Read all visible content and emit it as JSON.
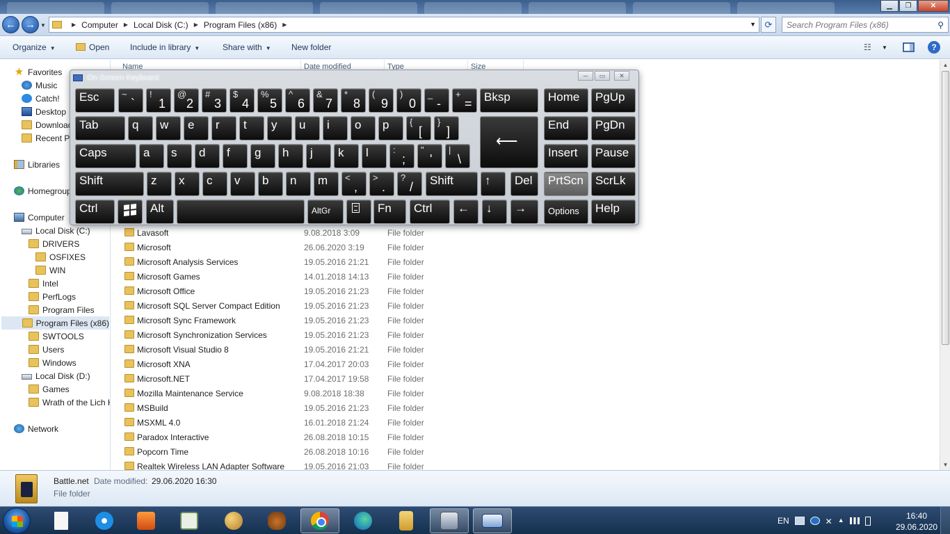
{
  "address_bar": {
    "crumbs": [
      "Computer",
      "Local Disk (C:)",
      "Program Files (x86)"
    ],
    "search_placeholder": "Search Program Files (x86)"
  },
  "toolbar": {
    "organize": "Organize",
    "open": "Open",
    "include": "Include in library",
    "share": "Share with",
    "new_folder": "New folder"
  },
  "nav": {
    "favorites": "Favorites",
    "music": "Music",
    "catch": "Catch!",
    "desktop": "Desktop",
    "downloads": "Download",
    "recent": "Recent Pl",
    "libraries": "Libraries",
    "homegroup": "Homegroup",
    "computer": "Computer",
    "local_c": "Local Disk (C:)",
    "drivers": "DRIVERS",
    "osfixes": "OSFIXES",
    "win": "WIN",
    "intel": "Intel",
    "perflogs": "PerfLogs",
    "program_files": "Program Files",
    "program_files_x86": "Program Files (x86)",
    "swtools": "SWTOOLS",
    "users": "Users",
    "windows": "Windows",
    "local_d": "Local Disk (D:)",
    "games": "Games",
    "wrath": "Wrath of the Lich Ki",
    "network": "Network"
  },
  "columns": {
    "name": "Name",
    "date": "Date modified",
    "type": "Type",
    "size": "Size"
  },
  "files": [
    {
      "name": "Lavasoft",
      "date": "9.08.2018 3:09",
      "type": "File folder"
    },
    {
      "name": "Microsoft",
      "date": "26.06.2020 3:19",
      "type": "File folder"
    },
    {
      "name": "Microsoft Analysis Services",
      "date": "19.05.2016 21:21",
      "type": "File folder"
    },
    {
      "name": "Microsoft Games",
      "date": "14.01.2018 14:13",
      "type": "File folder"
    },
    {
      "name": "Microsoft Office",
      "date": "19.05.2016 21:23",
      "type": "File folder"
    },
    {
      "name": "Microsoft SQL Server Compact Edition",
      "date": "19.05.2016 21:23",
      "type": "File folder"
    },
    {
      "name": "Microsoft Sync Framework",
      "date": "19.05.2016 21:23",
      "type": "File folder"
    },
    {
      "name": "Microsoft Synchronization Services",
      "date": "19.05.2016 21:23",
      "type": "File folder"
    },
    {
      "name": "Microsoft Visual Studio 8",
      "date": "19.05.2016 21:21",
      "type": "File folder"
    },
    {
      "name": "Microsoft XNA",
      "date": "17.04.2017 20:03",
      "type": "File folder"
    },
    {
      "name": "Microsoft.NET",
      "date": "17.04.2017 19:58",
      "type": "File folder"
    },
    {
      "name": "Mozilla Maintenance Service",
      "date": "9.08.2018 18:38",
      "type": "File folder"
    },
    {
      "name": "MSBuild",
      "date": "19.05.2016 21:23",
      "type": "File folder"
    },
    {
      "name": "MSXML 4.0",
      "date": "16.01.2018 21:24",
      "type": "File folder"
    },
    {
      "name": "Paradox Interactive",
      "date": "26.08.2018 10:15",
      "type": "File folder"
    },
    {
      "name": "Popcorn Time",
      "date": "26.08.2018 10:16",
      "type": "File folder"
    },
    {
      "name": "Realtek Wireless LAN Adapter Software",
      "date": "19.05.2016 21:03",
      "type": "File folder"
    }
  ],
  "details": {
    "name": "Battle.net",
    "date_label": "Date modified:",
    "date_value": "29.06.2020 16:30",
    "type": "File folder"
  },
  "osk": {
    "title": "On-Screen Keyboard",
    "keys": {
      "esc": "Esc",
      "bksp": "Bksp",
      "home": "Home",
      "pgup": "PgUp",
      "tab": "Tab",
      "end": "End",
      "pgdn": "PgDn",
      "caps": "Caps",
      "insert": "Insert",
      "pause": "Pause",
      "shift": "Shift",
      "del": "Del",
      "prtscn": "PrtScn",
      "scrlk": "ScrLk",
      "ctrl": "Ctrl",
      "alt": "Alt",
      "altgr": "AltGr",
      "fn": "Fn",
      "options": "Options",
      "help": "Help",
      "enter_glyph": "⟵",
      "arrow_up": "↑",
      "arrow_left": "←",
      "arrow_down": "↓",
      "arrow_right": "→"
    },
    "row1": [
      [
        "~",
        "`"
      ],
      [
        "!",
        "1"
      ],
      [
        "@",
        "2"
      ],
      [
        "#",
        "3"
      ],
      [
        "$",
        "4"
      ],
      [
        "%",
        "5"
      ],
      [
        "^",
        "6"
      ],
      [
        "&",
        "7"
      ],
      [
        "*",
        "8"
      ],
      [
        "(",
        "9"
      ],
      [
        ")",
        "0"
      ],
      [
        "_",
        "-"
      ],
      [
        "+",
        "="
      ]
    ],
    "row2": [
      "q",
      "w",
      "e",
      "r",
      "t",
      "y",
      "u",
      "i",
      "o",
      "p"
    ],
    "row2_brackets": [
      [
        "{",
        "["
      ],
      [
        "}",
        "]"
      ]
    ],
    "row3": [
      "a",
      "s",
      "d",
      "f",
      "g",
      "h",
      "j",
      "k",
      "l"
    ],
    "row3_punct": [
      [
        ":",
        ";"
      ],
      [
        "\"",
        "'"
      ],
      [
        "|",
        "\\"
      ]
    ],
    "row4": [
      "z",
      "x",
      "c",
      "v",
      "b",
      "n",
      "m"
    ],
    "row4_punct": [
      [
        "<",
        ","
      ],
      [
        ">",
        "."
      ],
      [
        "?",
        "/"
      ]
    ]
  },
  "tray": {
    "lang": "EN",
    "time": "16:40",
    "date": "29.06.2020"
  }
}
